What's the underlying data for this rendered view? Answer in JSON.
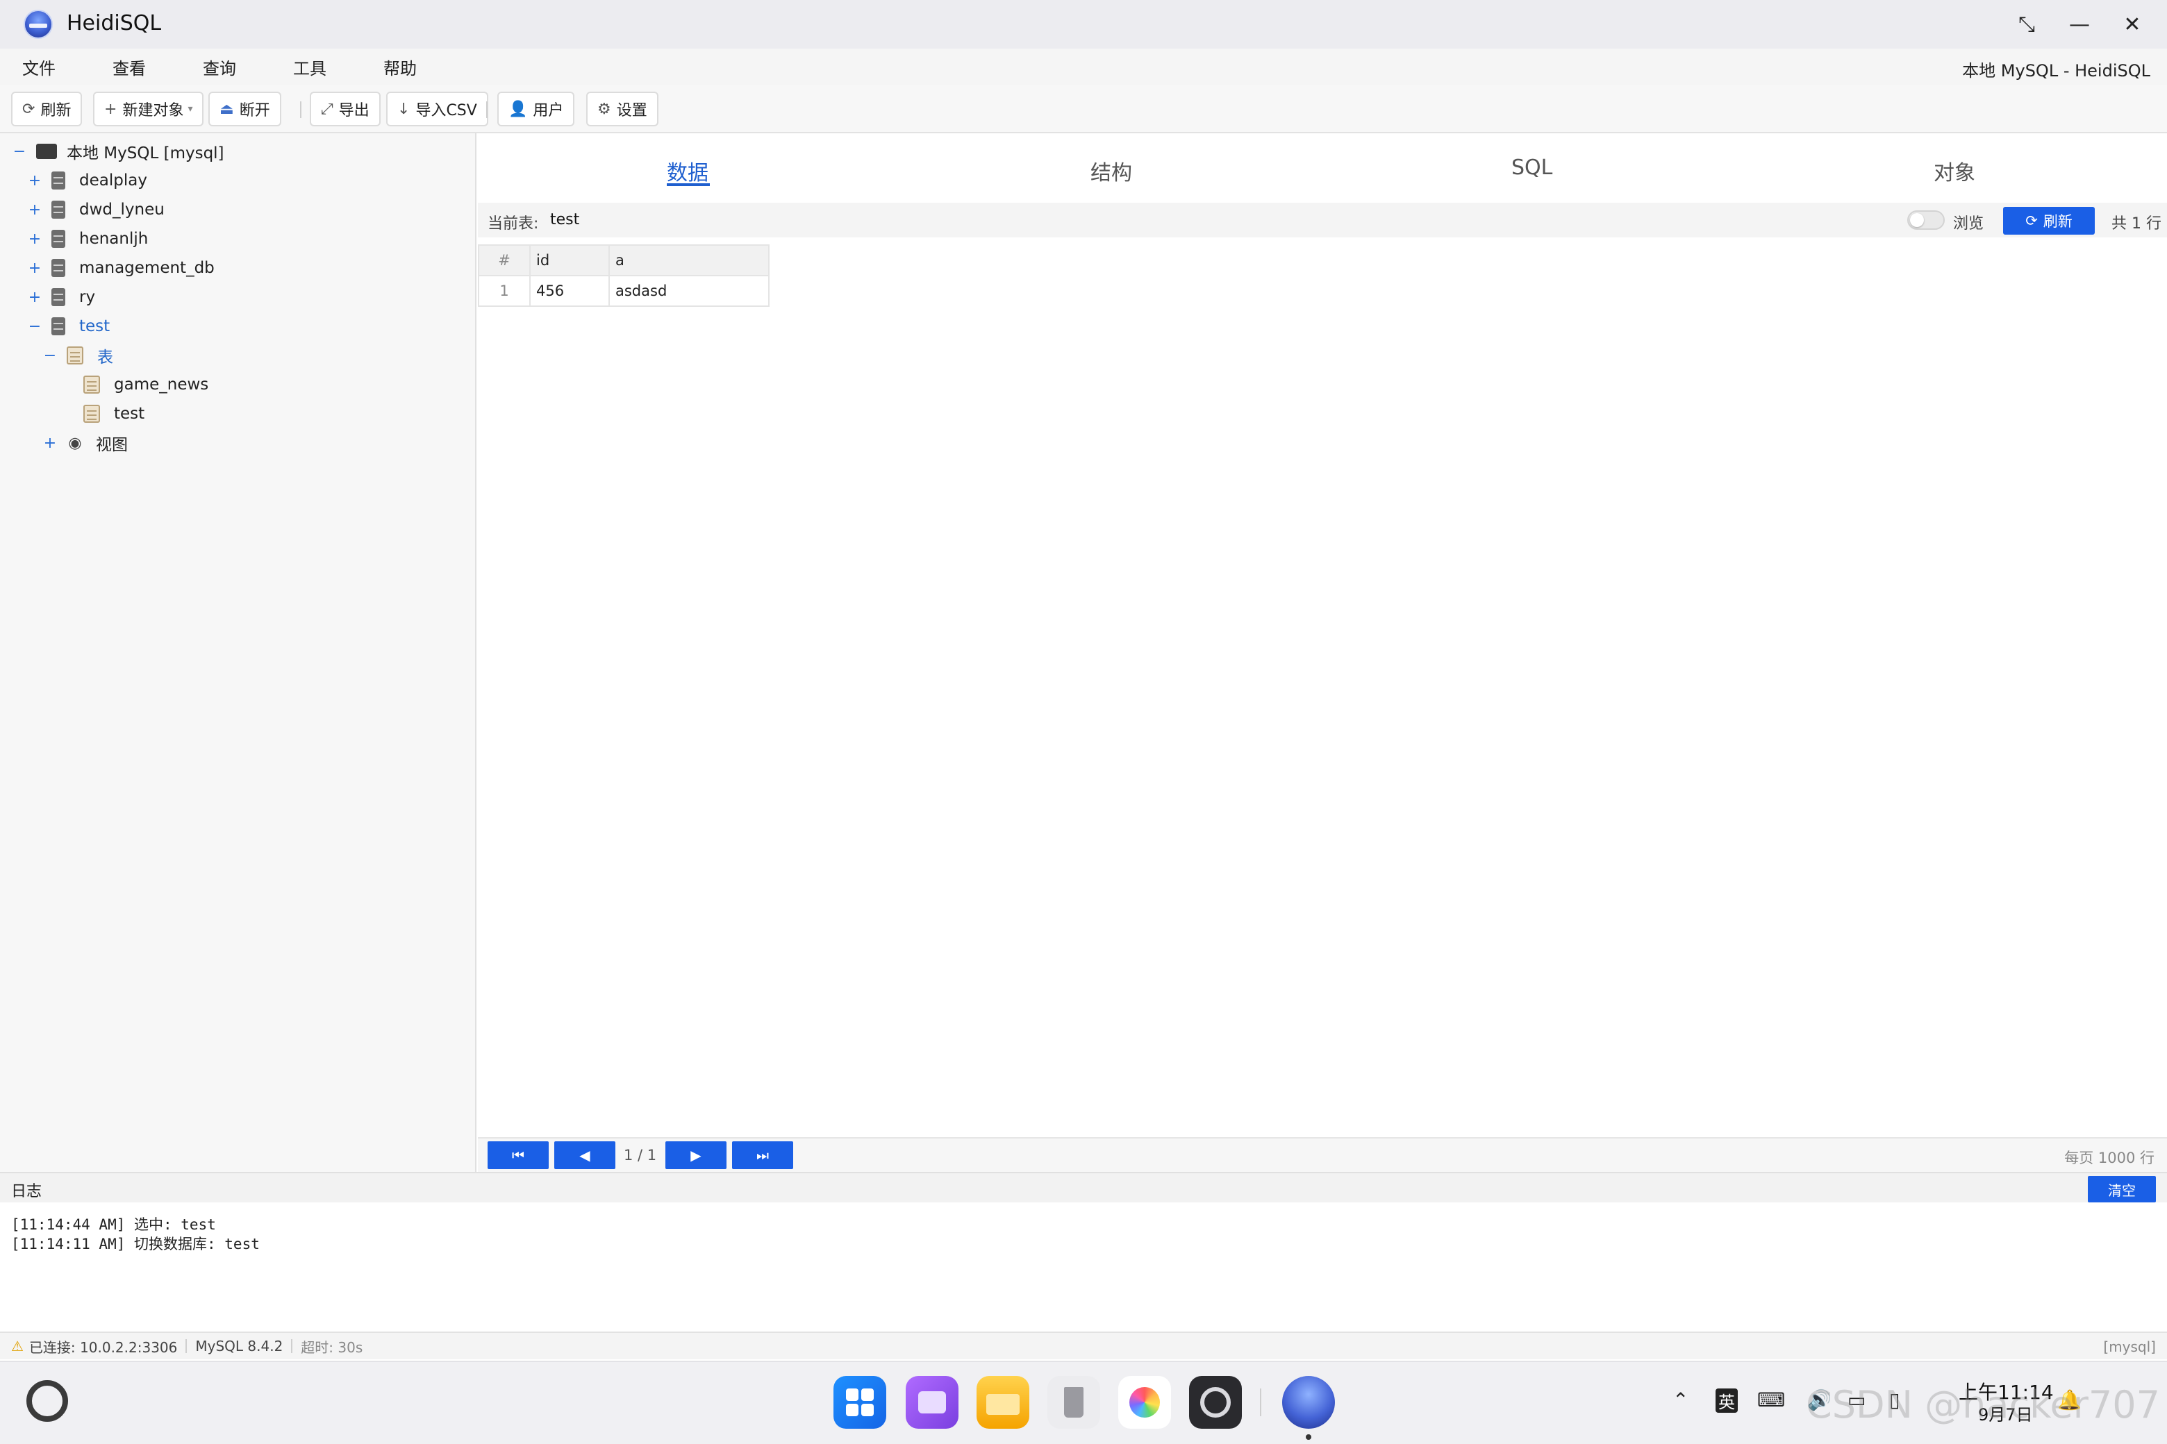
{
  "window": {
    "title": "HeidiSQL",
    "menu": [
      "文件",
      "查看",
      "查询",
      "工具",
      "帮助"
    ],
    "menu_right": "本地 MySQL - HeidiSQL"
  },
  "toolbar": {
    "refresh": "刷新",
    "new_object": "新建对象",
    "disconnect": "断开",
    "export": "导出",
    "import_csv": "导入CSV",
    "user": "用户",
    "settings": "设置"
  },
  "tree": {
    "root": "本地 MySQL [mysql]",
    "databases": [
      "dealplay",
      "dwd_lyneu",
      "henanljh",
      "management_db",
      "ry",
      "test"
    ],
    "tables_folder": "表",
    "tables": [
      "game_news",
      "test"
    ],
    "views_folder": "视图"
  },
  "tabs": [
    "数据",
    "结构",
    "SQL",
    "对象"
  ],
  "subbar": {
    "current_label": "当前表:",
    "current_value": "test",
    "browse_label": "浏览",
    "refresh_label": "刷新",
    "row_count": "共 1 行"
  },
  "grid": {
    "headers": [
      "#",
      "id",
      "a"
    ],
    "rows": [
      [
        "1",
        "456",
        "asdasd"
      ]
    ]
  },
  "pager": {
    "page_text": "1 / 1",
    "per_page": "每页 1000 行"
  },
  "log": {
    "title": "日志",
    "clear_label": "清空",
    "lines": [
      "[11:14:44 AM] 选中: test",
      "[11:14:11 AM] 切换数据库: test"
    ]
  },
  "status": {
    "connected": "已连接: 10.0.2.2:3306",
    "version": "MySQL 8.4.2",
    "timeout": "超时: 30s",
    "right": "[mysql]"
  },
  "taskbar": {
    "ime": "英",
    "time": "上午11:14",
    "date": "9月7日",
    "watermark": "CSDN @hacker707"
  },
  "colors": {
    "accent": "#1a5fe6",
    "tab_active": "#1f5fcf"
  }
}
